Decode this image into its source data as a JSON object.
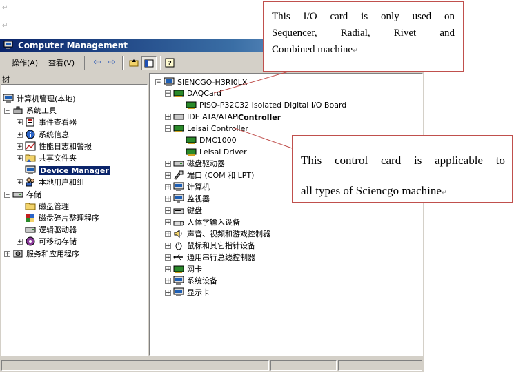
{
  "doc_marks": {
    "paragraph_mark": "↵"
  },
  "window": {
    "title": "Computer Management",
    "menu": {
      "action": "操作(A)",
      "view": "查看(V)"
    },
    "toolbar_icons": [
      "back-arrow-icon",
      "forward-arrow-icon",
      "up-level-icon",
      "show-hide-tree-icon",
      "help-icon"
    ]
  },
  "left_pane": {
    "tab_label": "树",
    "root": "计算机管理(本地)",
    "system_tools": "系统工具",
    "event_viewer": "事件查看器",
    "system_info": "系统信息",
    "perf_logs": "性能日志和警报",
    "shared_folders": "共享文件夹",
    "device_manager": "Device Manager",
    "local_users": "本地用户和组",
    "storage": "存储",
    "disk_management": "磁盘管理",
    "disk_defrag": "磁盘碎片整理程序",
    "logical_drives": "逻辑驱动器",
    "removable_storage": "可移动存储",
    "services_apps": "服务和应用程序"
  },
  "right_pane": {
    "computer": "SIENCGO-H3RI0LX",
    "daqcard": "DAQCard",
    "piso": "PISO-P32C32 Isolated Digital I/O Board",
    "ide": "IDE ATA/ATAPI",
    "controller_overlay": "Controller",
    "leisai": "Leisai Controller",
    "dmc1000": "DMC1000",
    "leisai_driver": "Leisai Driver",
    "disk_drives": "磁盘驱动器",
    "ports": "端口 (COM 和 LPT)",
    "computer_cat": "计算机",
    "monitors": "监视器",
    "keyboard": "键盘",
    "hid": "人体学输入设备",
    "sound": "声音、视频和游戏控制器",
    "mouse": "鼠标和其它指针设备",
    "usb": "通用串行总线控制器",
    "network": "网卡",
    "system_devices": "系统设备",
    "display": "显示卡"
  },
  "callouts": {
    "io_card": [
      "This I/O card is only used on",
      "Sequencer, Radial, Rivet and",
      "Combined machine"
    ],
    "control_card": [
      "This control card is applicable to",
      "all types of Sciencgo machine"
    ]
  },
  "colors": {
    "title_dark": "#0a246a",
    "title_light": "#a6caf0",
    "callout_border": "#c0504d",
    "selection": "#0a246a"
  }
}
